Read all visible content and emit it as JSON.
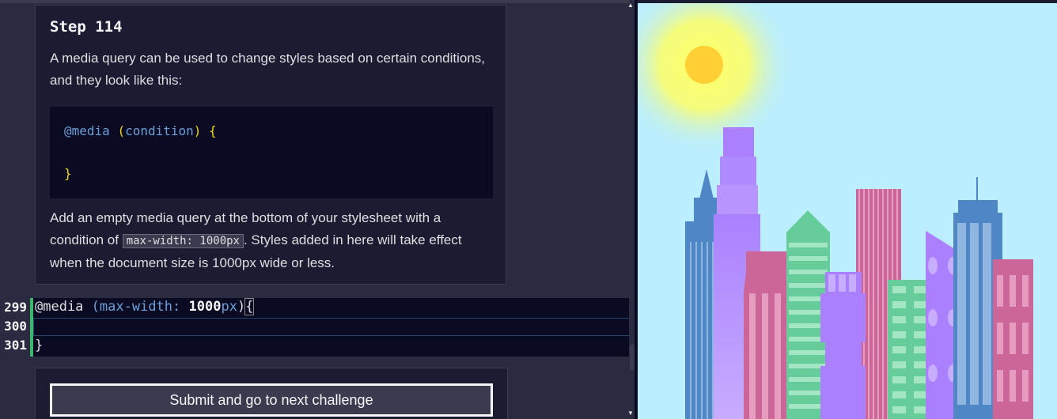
{
  "instructions": {
    "step_title": "Step 114",
    "para1": "A media query can be used to change styles based on certain conditions, and they look like this:",
    "example_line1_at": "@media",
    "example_line1_open": "(",
    "example_line1_cond": "condition",
    "example_line1_close": ")",
    "example_line1_brace": "{",
    "example_line2": "}",
    "para2_part1": "Add an empty media query at the bottom of your stylesheet with a condition of ",
    "para2_code": "max-width: 1000px",
    "para2_part2": ". Styles added in here will take effect when the document size is 1000px wide or less."
  },
  "editor": {
    "lines": [
      {
        "number": "299"
      },
      {
        "number": "300"
      },
      {
        "number": "301"
      }
    ],
    "line299": {
      "at": "@media",
      "open": " (",
      "prop": "max-width",
      "colon": ":",
      "num": " 1000",
      "unit": "px",
      "close": ")",
      "brace": "{"
    },
    "line301": "}"
  },
  "actions": {
    "submit_label": "Submit and go to next challenge"
  },
  "colors": {
    "sky": "#bbeefe",
    "sun": "#ffcf33",
    "blue_building": "#4f86c6",
    "purple_building": "#aa80ff",
    "pink_building": "#cc6699",
    "green_building": "#66cc99"
  }
}
